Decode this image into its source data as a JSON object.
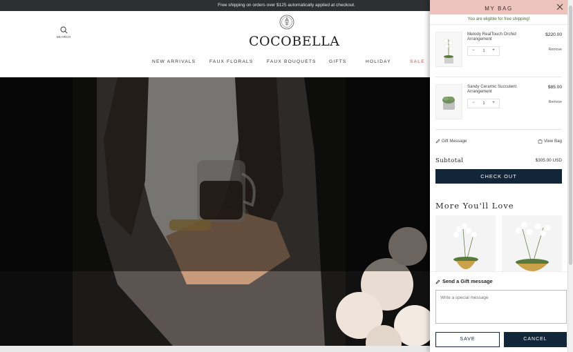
{
  "promo": {
    "text": "Free shipping on orders over $125 automatically applied at checkout."
  },
  "header": {
    "search_label": "SEARCH",
    "logo_text": "COCOBELLA",
    "nav": [
      {
        "label": "NEW ARRIVALS"
      },
      {
        "label": "FAUX FLORALS"
      },
      {
        "label": "FAUX BOUQUETS"
      },
      {
        "label": "GIFTS"
      },
      {
        "label": "HOLIDAY"
      },
      {
        "label": "SALE"
      }
    ]
  },
  "cart": {
    "title": "MY BAG",
    "free_shipping_notice": "You are eligible for free shipping!",
    "items": [
      {
        "name": "Melody RealTouch Orchid Arrangement",
        "price": "$220.00",
        "quantity": "1",
        "remove_label": "Remove"
      },
      {
        "name": "Sandy Ceramic Succulent Arrangement",
        "price": "$85.00",
        "quantity": "1",
        "remove_label": "Remove"
      }
    ],
    "gift_message_label": "Gift Message",
    "view_bag_label": "View Bag",
    "subtotal_label": "Subtotal",
    "subtotal_value": "$305.00 USD",
    "checkout_label": "CHECK OUT",
    "more_title": "More You'll Love"
  },
  "gift_panel": {
    "title": "Send a Gift message",
    "placeholder": "Write a special message",
    "save_label": "SAVE",
    "cancel_label": "CANCEL"
  },
  "colors": {
    "promo_bg": "#2d2f33",
    "drawer_header_bg": "#ecc4bd",
    "primary_navy": "#12263a",
    "sale_red": "#c25050",
    "free_ship_green": "#4a6b3c"
  }
}
